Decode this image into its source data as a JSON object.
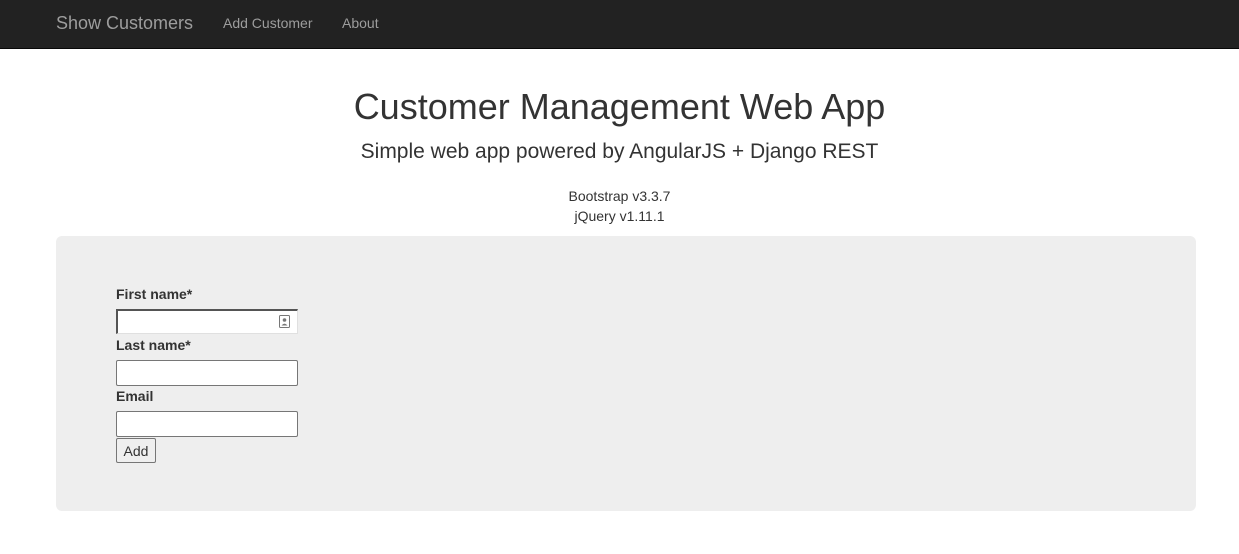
{
  "navbar": {
    "brand": "Show Customers",
    "links": [
      "Add Customer",
      "About"
    ]
  },
  "header": {
    "title": "Customer Management Web App",
    "subtitle": "Simple web app powered by AngularJS + Django REST",
    "versions": [
      "Bootstrap v3.3.7",
      "jQuery v1.11.1"
    ]
  },
  "form": {
    "first_name": {
      "label": "First name*",
      "value": "",
      "placeholder": ""
    },
    "last_name": {
      "label": "Last name*",
      "value": "",
      "placeholder": ""
    },
    "email": {
      "label": "Email",
      "value": "",
      "placeholder": ""
    },
    "submit_label": "Add"
  },
  "colors": {
    "navbar_bg": "#222222",
    "navbar_text": "#9d9d9d",
    "jumbotron_bg": "#eeeeee",
    "text": "#333333"
  },
  "icons": {
    "first_name_autofill": "contact-card-icon"
  }
}
